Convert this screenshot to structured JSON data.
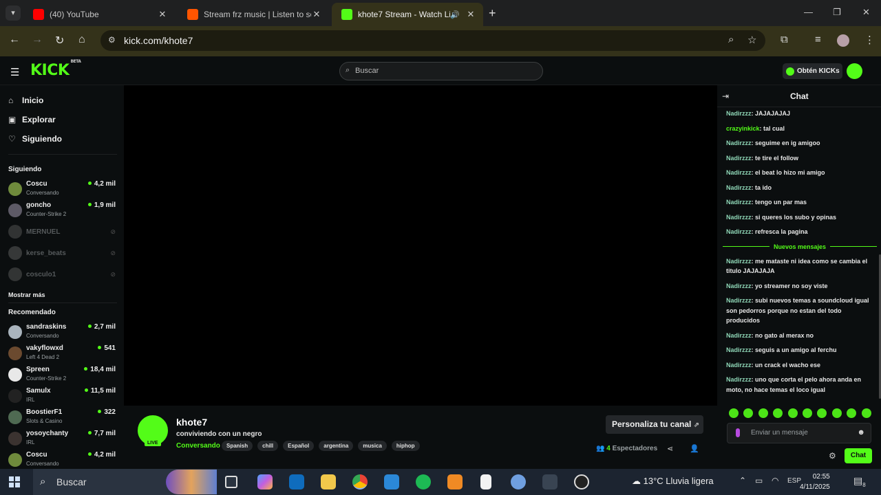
{
  "browser": {
    "tabs": [
      {
        "title": "(40) YouTube",
        "active": false
      },
      {
        "title": "Stream frz music | Listen to son",
        "active": false
      },
      {
        "title": "khote7 Stream - Watch Live",
        "active": true
      }
    ],
    "url": "kick.com/khote7"
  },
  "header": {
    "logo": "KICK",
    "logo_badge": "BETA",
    "search_placeholder": "Buscar",
    "kicks_label": "Obtén KICKs"
  },
  "sidebar": {
    "nav": [
      {
        "label": "Inicio",
        "icon": "home-icon"
      },
      {
        "label": "Explorar",
        "icon": "compass-icon"
      },
      {
        "label": "Siguiendo",
        "icon": "heart-icon"
      }
    ],
    "following_heading": "Siguiendo",
    "following": [
      {
        "name": "Coscu",
        "category": "Conversando",
        "viewers": "4,2 mil",
        "live": true
      },
      {
        "name": "goncho",
        "category": "Counter-Strike 2",
        "viewers": "1,9 mil",
        "live": true
      },
      {
        "name": "MERNUEL",
        "live": false
      },
      {
        "name": "kerse_beats",
        "live": false
      },
      {
        "name": "cosculo1",
        "live": false
      }
    ],
    "show_more": "Mostrar más",
    "recommended_heading": "Recomendado",
    "recommended": [
      {
        "name": "sandraskins",
        "category": "Conversando",
        "viewers": "2,7 mil"
      },
      {
        "name": "vakyflowxd",
        "category": "Left 4 Dead 2",
        "viewers": "541"
      },
      {
        "name": "Spreen",
        "category": "Counter-Strike 2",
        "viewers": "18,4 mil"
      },
      {
        "name": "Samulx",
        "category": "IRL",
        "viewers": "11,5 mil"
      },
      {
        "name": "BoostierF1",
        "category": "Slots & Casino",
        "viewers": "322"
      },
      {
        "name": "yosoychanty",
        "category": "IRL",
        "viewers": "7,7 mil"
      },
      {
        "name": "Coscu",
        "category": "Conversando",
        "viewers": "4,2 mil"
      }
    ]
  },
  "stream": {
    "channel": "khote7",
    "live_badge": "LIVE",
    "title": "conviviendo con un negro",
    "category": "Conversando",
    "tags": [
      "Spanish",
      "chill",
      "Español",
      "argentina",
      "musica",
      "hiphop"
    ],
    "customize_label": "Personaliza tu canal",
    "viewers_count": "4",
    "viewers_label": "Espectadores"
  },
  "chat": {
    "title": "Chat",
    "messages_before": [
      {
        "user": "Nadirzzz",
        "text": "JAJAJAJAJ"
      },
      {
        "user": "crazyinkick",
        "text": "tal cual"
      },
      {
        "user": "Nadirzzz",
        "text": "seguime en ig amigoo"
      },
      {
        "user": "Nadirzzz",
        "text": "te tire el follow"
      },
      {
        "user": "Nadirzzz",
        "text": "el beat lo hizo mi amigo"
      },
      {
        "user": "Nadirzzz",
        "text": "ta ido"
      },
      {
        "user": "Nadirzzz",
        "text": "tengo un par mas"
      },
      {
        "user": "Nadirzzz",
        "text": "si queres los subo y opinas"
      },
      {
        "user": "Nadirzzz",
        "text": "refresca la pagina"
      }
    ],
    "new_messages_label": "Nuevos mensajes",
    "messages_after": [
      {
        "user": "Nadirzzz",
        "text": "me mataste ni idea como se cambia el titulo JAJAJAJA"
      },
      {
        "user": "Nadirzzz",
        "text": "yo streamer no soy viste"
      },
      {
        "user": "Nadirzzz",
        "text": "subi nuevos temas a soundcloud igual son pedorros porque no estan del todo producidos"
      },
      {
        "user": "Nadirzzz",
        "text": "no gato al merax no"
      },
      {
        "user": "Nadirzzz",
        "text": "seguis a un amigo al ferchu"
      },
      {
        "user": "Nadirzzz",
        "text": "un crack el wacho ese"
      },
      {
        "user": "Nadirzzz",
        "text": "uno que corta el pelo ahora anda en moto, no hace temas el loco igual"
      }
    ],
    "input_placeholder": "Enviar un mensaje",
    "send_label": "Chat"
  },
  "taskbar": {
    "search_label": "Buscar",
    "weather": "13°C  Lluvia ligera",
    "language": "ESP",
    "time": "02:55",
    "date": "4/11/2025",
    "notifications": "8"
  },
  "colors": {
    "accent": "#53fc18",
    "background": "#0b0e0f",
    "username": "#8fd7b7"
  }
}
